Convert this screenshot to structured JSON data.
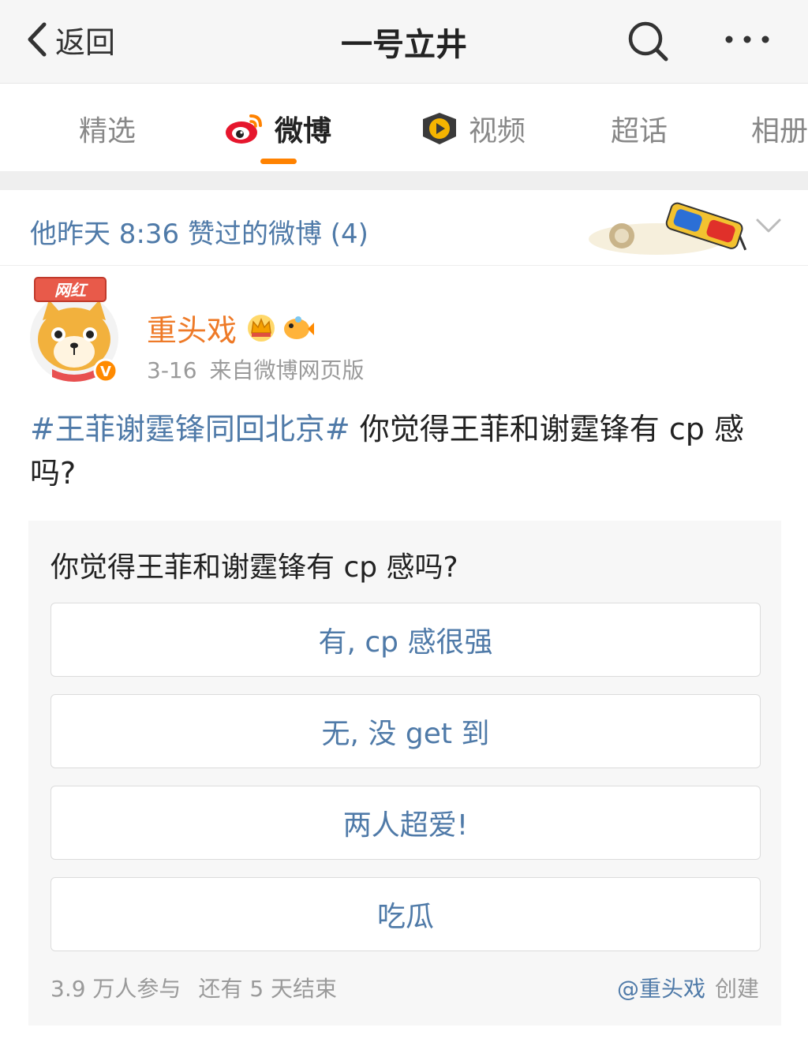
{
  "header": {
    "back_label": "返回",
    "title": "一号立井",
    "back_icon": "chevron-left-icon",
    "search_icon": "search-icon",
    "more_icon": "more-icon"
  },
  "tabs": [
    {
      "label": "精选",
      "icon": null,
      "active": false
    },
    {
      "label": "微博",
      "icon": "weibo-logo-icon",
      "active": true
    },
    {
      "label": "视频",
      "icon": "video-play-icon",
      "active": false
    },
    {
      "label": "超话",
      "icon": null,
      "active": false
    },
    {
      "label": "相册",
      "icon": null,
      "active": false
    }
  ],
  "liked_banner": {
    "text": "他昨天 8:36 赞过的微博 (4)",
    "chevron_icon": "chevron-down-icon"
  },
  "post": {
    "author": "重头戏",
    "author_color": "#ee7a28",
    "avatar_badge": "网红",
    "date": "3-16",
    "source": "来自微博网页版",
    "topic": "#王菲谢霆锋同回北京#",
    "text": " 你觉得王菲和谢霆锋有 cp 感吗?"
  },
  "poll": {
    "question": "你觉得王菲和谢霆锋有 cp 感吗?",
    "options": [
      {
        "label": "有, cp 感很强"
      },
      {
        "label": "无, 没 get 到"
      },
      {
        "label": "两人超爱!"
      },
      {
        "label": "吃瓜"
      }
    ],
    "participants": "3.9 万人参与",
    "time_left": "还有 5 天结束",
    "creator": "@重头戏",
    "created_label": "创建"
  },
  "colors": {
    "accent": "#ff8200",
    "link": "#4f7aa8",
    "muted": "#9a9a9a"
  }
}
